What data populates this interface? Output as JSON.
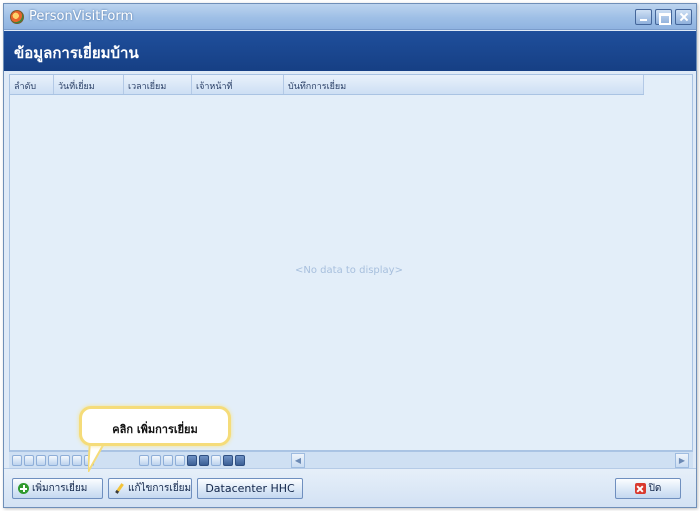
{
  "window": {
    "title": "PersonVisitForm"
  },
  "header": {
    "title": "ข้อมูลการเยี่ยมบ้าน"
  },
  "grid": {
    "columns": [
      "ลำดับ",
      "วันที่เยี่ยม",
      "เวลาเยี่ยม",
      "เจ้าหน้าที่",
      "บันทึกการเยี่ยม"
    ],
    "empty_text": "<No data to display>"
  },
  "toolbar": {
    "add_label": "เพิ่มการเยี่ยม",
    "edit_label": "แก้ไขการเยี่ยม",
    "datacenter_label": "Datacenter HHC",
    "close_label": "ปิด"
  },
  "callout": {
    "text": "คลิก เพิ่มการเยี่ยม"
  },
  "icons": [
    "app-icon",
    "minimize-icon",
    "maximize-icon",
    "close-icon",
    "add-icon",
    "pencil-icon",
    "close-x-icon"
  ]
}
